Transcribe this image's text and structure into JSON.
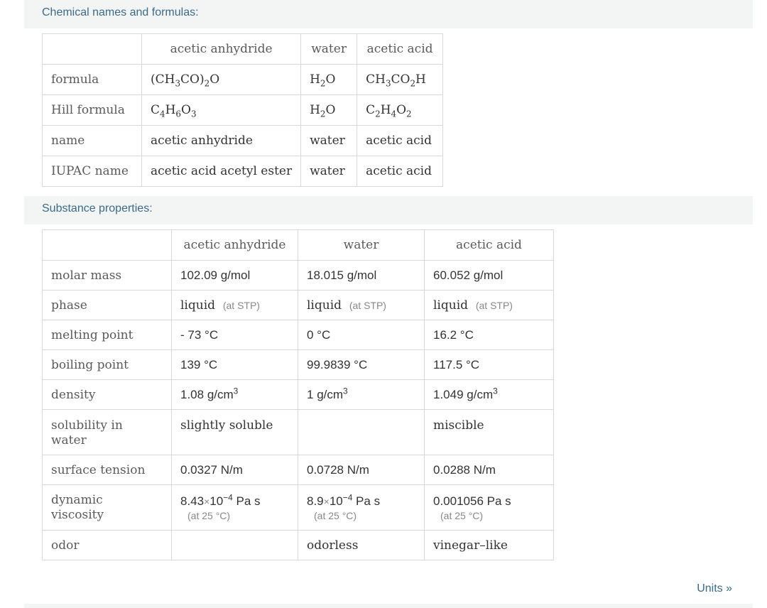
{
  "sections": {
    "chemical_names": {
      "title": "Chemical names and formulas:",
      "columns": [
        "acetic anhydride",
        "water",
        "acetic acid"
      ],
      "rows": [
        {
          "label": "formula"
        },
        {
          "label": "Hill formula"
        },
        {
          "label": "name",
          "cells": [
            "acetic anhydride",
            "water",
            "acetic acid"
          ]
        },
        {
          "label": "IUPAC name",
          "cells": [
            "acetic acid acetyl ester",
            "water",
            "acetic acid"
          ]
        }
      ],
      "formula_parts": {
        "anhydride": [
          "(CH",
          "3",
          "CO)",
          "2",
          "O"
        ],
        "water": [
          "H",
          "2",
          "O"
        ],
        "acid": [
          "CH",
          "3",
          "CO",
          "2",
          "H"
        ]
      },
      "hill_parts": {
        "anhydride": [
          "C",
          "4",
          "H",
          "6",
          "O",
          "3"
        ],
        "water": [
          "H",
          "2",
          "O"
        ],
        "acid": [
          "C",
          "2",
          "H",
          "4",
          "O",
          "2"
        ]
      }
    },
    "substance_properties": {
      "title": "Substance properties:",
      "columns": [
        "acetic anhydride",
        "water",
        "acetic acid"
      ],
      "row_labels": {
        "molar_mass": "molar mass",
        "phase": "phase",
        "melting_point": "melting point",
        "boiling_point": "boiling point",
        "density": "density",
        "solubility_l1": "solubility in",
        "solubility_l2": "water",
        "surface_tension": "surface tension",
        "viscosity_l1": "dynamic",
        "viscosity_l2": "viscosity",
        "odor": "odor"
      },
      "molar_mass": [
        "102.09 g/mol",
        "18.015 g/mol",
        "60.052 g/mol"
      ],
      "phase": [
        "liquid",
        "liquid",
        "liquid"
      ],
      "phase_note": "(at STP)",
      "melting_point": [
        "- 73 °C",
        "0 °C",
        "16.2 °C"
      ],
      "boiling_point": [
        "139 °C",
        "99.9839 °C",
        "117.5 °C"
      ],
      "density": {
        "values": [
          "1.08",
          "1",
          "1.049"
        ],
        "unit": "g/cm",
        "exp": "3"
      },
      "solubility": [
        "slightly soluble",
        "",
        "miscible"
      ],
      "surface_tension": [
        "0.0327 N/m",
        "0.0728 N/m",
        "0.0288 N/m"
      ],
      "viscosity": {
        "anhydride": {
          "mantissa": "8.43",
          "times": "×",
          "base": "10",
          "exp": "−4",
          "unit": "Pa s"
        },
        "water": {
          "mantissa": "8.9",
          "times": "×",
          "base": "10",
          "exp": "−4",
          "unit": "Pa s"
        },
        "acid": {
          "value": "0.001056",
          "unit": "Pa s"
        },
        "note": "(at 25 °C)"
      },
      "odor": [
        "",
        "odorless",
        "vinegar–like"
      ]
    }
  },
  "footer": {
    "units_link": "Units »"
  }
}
